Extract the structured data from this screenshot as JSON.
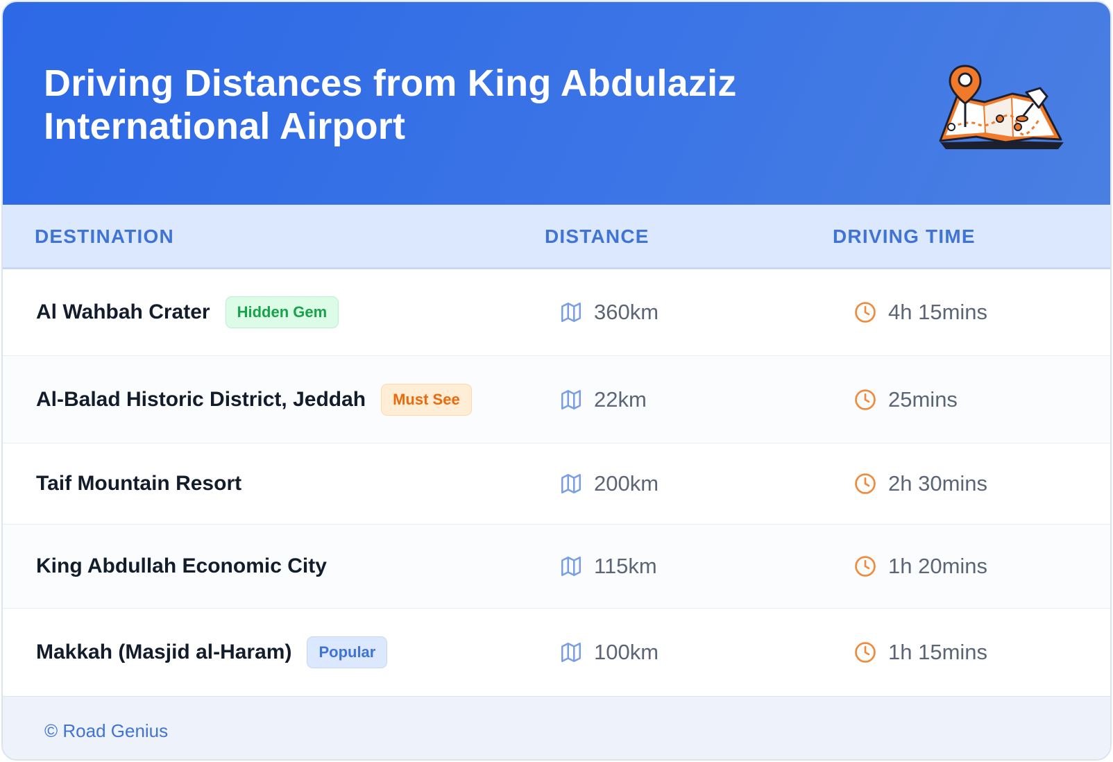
{
  "header": {
    "title_line1": "Driving Distances from King Abdulaziz",
    "title_line2": "International Airport",
    "illustration": "folded-map-with-pins-icon"
  },
  "table": {
    "columns": [
      "DESTINATION",
      "DISTANCE",
      "DRIVING TIME"
    ],
    "distance_icon": "map-icon",
    "time_icon": "clock-icon",
    "rows": [
      {
        "destination": "Al Wahbah Crater",
        "badge": "Hidden Gem",
        "badge_color": "#16a34a",
        "distance": "360km",
        "time": "4h 15mins"
      },
      {
        "destination": "Al-Balad Historic District, Jeddah",
        "badge": "Must See",
        "badge_color": "#ea6a0c",
        "distance": "22km",
        "time": "25mins"
      },
      {
        "destination": "Taif Mountain Resort",
        "badge": "",
        "distance": "200km",
        "time": "2h 30mins"
      },
      {
        "destination": "King Abdullah Economic City",
        "badge": "",
        "distance": "115km",
        "time": "1h 20mins"
      },
      {
        "destination": "Makkah (Masjid al-Haram)",
        "badge": "Popular",
        "badge_color": "#3f73d6",
        "distance": "100km",
        "time": "1h 15mins"
      }
    ]
  },
  "footer": {
    "text": "© Road Genius"
  },
  "colors": {
    "header_blue": "#2d68e6",
    "accent_blue": "#3f73d6",
    "clock_orange": "#f08a3c",
    "map_icon_blue": "#7a9ee6"
  }
}
